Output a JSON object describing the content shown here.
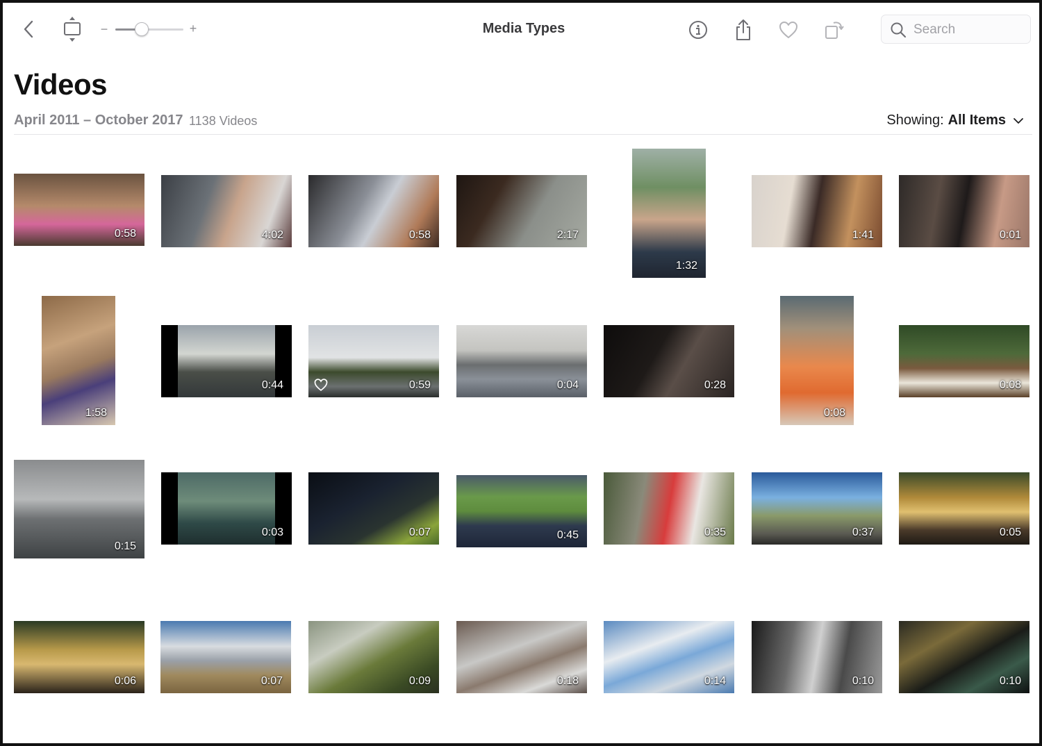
{
  "toolbar": {
    "title": "Media Types",
    "zoom_minus": "−",
    "zoom_plus": "+",
    "zoom_level": 0.38,
    "search_placeholder": "Search"
  },
  "header": {
    "title": "Videos",
    "date_range": "April 2011 – October 2017",
    "count": "1138 Videos",
    "showing_label": "Showing:",
    "showing_value": "All Items"
  },
  "videos": [
    {
      "duration": "0:58",
      "favorite": false
    },
    {
      "duration": "4:02",
      "favorite": false
    },
    {
      "duration": "0:58",
      "favorite": false
    },
    {
      "duration": "2:17",
      "favorite": false
    },
    {
      "duration": "1:32",
      "favorite": false
    },
    {
      "duration": "1:41",
      "favorite": false
    },
    {
      "duration": "0:01",
      "favorite": false
    },
    {
      "duration": "1:58",
      "favorite": false
    },
    {
      "duration": "0:44",
      "favorite": false
    },
    {
      "duration": "0:59",
      "favorite": true
    },
    {
      "duration": "0:04",
      "favorite": false
    },
    {
      "duration": "0:28",
      "favorite": false
    },
    {
      "duration": "0:08",
      "favorite": false
    },
    {
      "duration": "0:08",
      "favorite": false
    },
    {
      "duration": "0:15",
      "favorite": false
    },
    {
      "duration": "0:03",
      "favorite": false
    },
    {
      "duration": "0:07",
      "favorite": false
    },
    {
      "duration": "0:45",
      "favorite": false
    },
    {
      "duration": "0:35",
      "favorite": false
    },
    {
      "duration": "0:37",
      "favorite": false
    },
    {
      "duration": "0:05",
      "favorite": false
    },
    {
      "duration": "0:06",
      "favorite": false
    },
    {
      "duration": "0:07",
      "favorite": false
    },
    {
      "duration": "0:09",
      "favorite": false
    },
    {
      "duration": "0:18",
      "favorite": false
    },
    {
      "duration": "0:14",
      "favorite": false
    },
    {
      "duration": "0:10",
      "favorite": false
    },
    {
      "duration": "0:10",
      "favorite": false
    }
  ]
}
